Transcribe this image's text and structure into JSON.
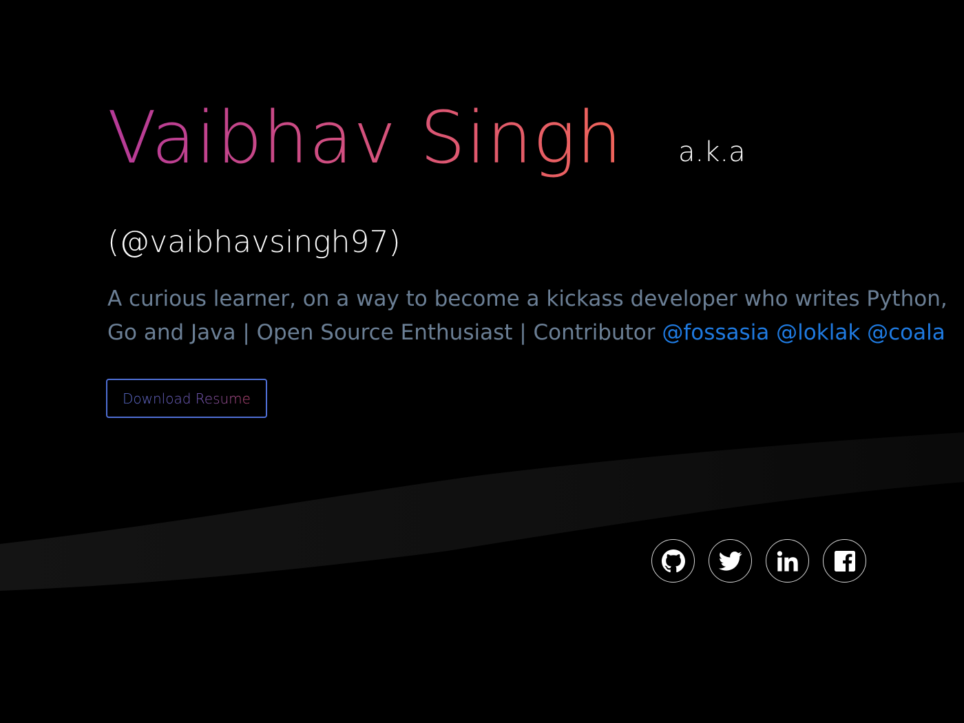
{
  "header": {
    "name": "Vaibhav Singh",
    "aka": "a.k.a",
    "handle": "(@vaibhavsingh97)"
  },
  "bio": {
    "text": "A curious learner, on a way to become a kickass developer who writes Python, Go and Java | Open Source Enthusiast | Contributor ",
    "links": [
      {
        "label": "@fossasia"
      },
      {
        "label": "@loklak"
      },
      {
        "label": "@coala"
      }
    ]
  },
  "actions": {
    "resume_label": "Download Resume"
  },
  "social": [
    {
      "icon": "github-icon"
    },
    {
      "icon": "twitter-icon"
    },
    {
      "icon": "linkedin-icon"
    },
    {
      "icon": "facebook-icon"
    }
  ],
  "colors": {
    "background": "#000000",
    "name_gradient_start": "#b63a98",
    "name_gradient_end": "#f0645a",
    "bio_text": "#6b7f95",
    "link": "#1f7ae0",
    "button_border": "#4f6fd6"
  }
}
